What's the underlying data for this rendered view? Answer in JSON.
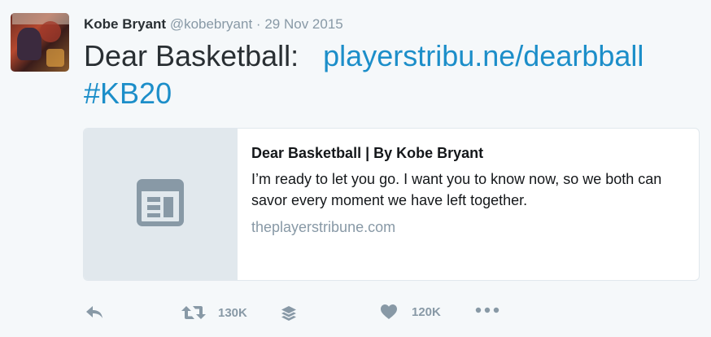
{
  "tweet": {
    "author_name": "Kobe Bryant",
    "author_handle": "@kobebryant",
    "separator": "·",
    "date": "29 Nov 2015",
    "text_prefix": "Dear Basketball:",
    "link_text": "playerstribu.ne/dearbball",
    "hashtag": "#KB20"
  },
  "card": {
    "title": "Dear Basketball | By Kobe Bryant",
    "description": "I’m ready to let you go. I want you to know now, so we both can savor every moment we have left together.",
    "domain": "theplayerstribune.com",
    "thumbnail_icon": "article-icon"
  },
  "actions": {
    "reply_icon": "reply-icon",
    "retweet_icon": "retweet-icon",
    "retweet_count": "130K",
    "buffer_icon": "layers-icon",
    "like_icon": "heart-icon",
    "like_count": "120K",
    "more_icon": "more-icon"
  },
  "colors": {
    "background": "#f5f8fa",
    "link": "#1c8ec9",
    "muted": "#8899a6",
    "text": "#292f33"
  }
}
